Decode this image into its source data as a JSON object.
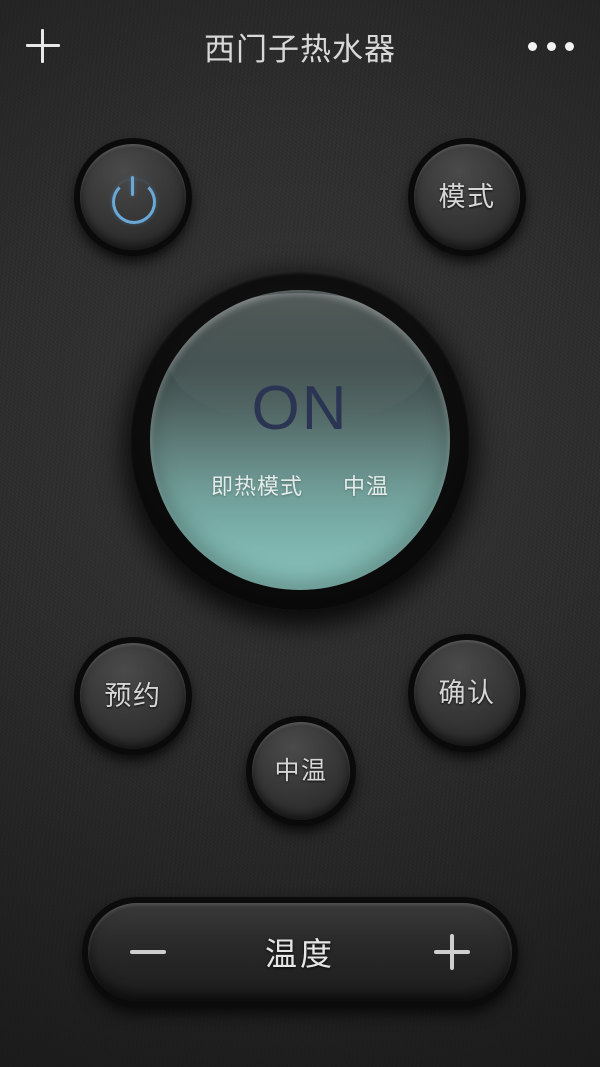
{
  "header": {
    "title": "西门子热水器",
    "add_icon": "plus-icon",
    "more_icon": "more-options-icon"
  },
  "controls": {
    "power": {
      "label": "",
      "icon": "power-icon",
      "accent": "#6aa8d8"
    },
    "mode": {
      "label": "模式"
    },
    "schedule": {
      "label": "预约"
    },
    "confirm": {
      "label": "确认"
    },
    "temp_level": {
      "label": "中温"
    }
  },
  "display": {
    "state": "ON",
    "mode_text": "即热模式",
    "temp_text": "中温",
    "state_color": "#2b3553",
    "face_top_color": "#242d2d",
    "face_bottom_color": "#8ac6bf"
  },
  "temperature_bar": {
    "label": "温度",
    "decrease_icon": "minus-icon",
    "increase_icon": "plus-icon"
  },
  "theme": {
    "background": "#2b2b2b",
    "knob_face": "#3b3b3b",
    "text_primary": "#d8d8d8"
  }
}
